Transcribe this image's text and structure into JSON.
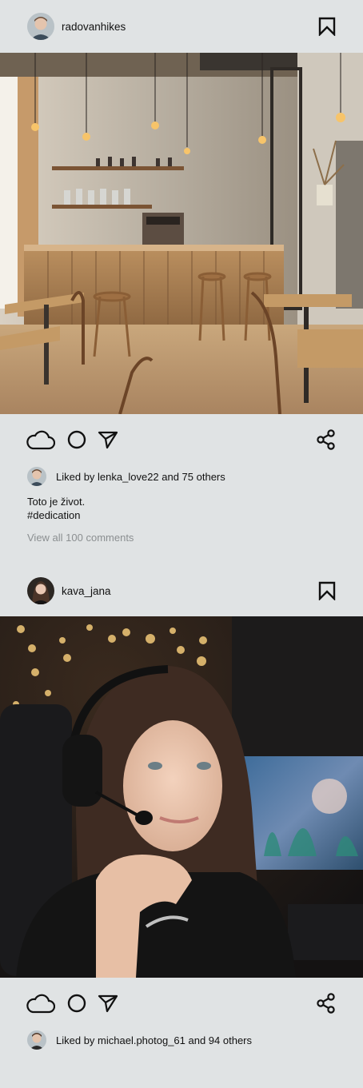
{
  "posts": [
    {
      "username": "radovanhikes",
      "likes_text": "Liked by lenka_love22 and 75 others",
      "caption_line1": "Toto je život.",
      "caption_line2": "#dedication",
      "view_comments": "View all 100 comments",
      "icons": [
        "cloud-icon",
        "comment-circle-icon",
        "send-icon",
        "share-icon",
        "bookmark-icon"
      ]
    },
    {
      "username": "kava_jana",
      "likes_text": "Liked by michael.photog_61 and 94 others",
      "icons": [
        "cloud-icon",
        "comment-circle-icon",
        "send-icon",
        "share-icon",
        "bookmark-icon"
      ]
    }
  ]
}
